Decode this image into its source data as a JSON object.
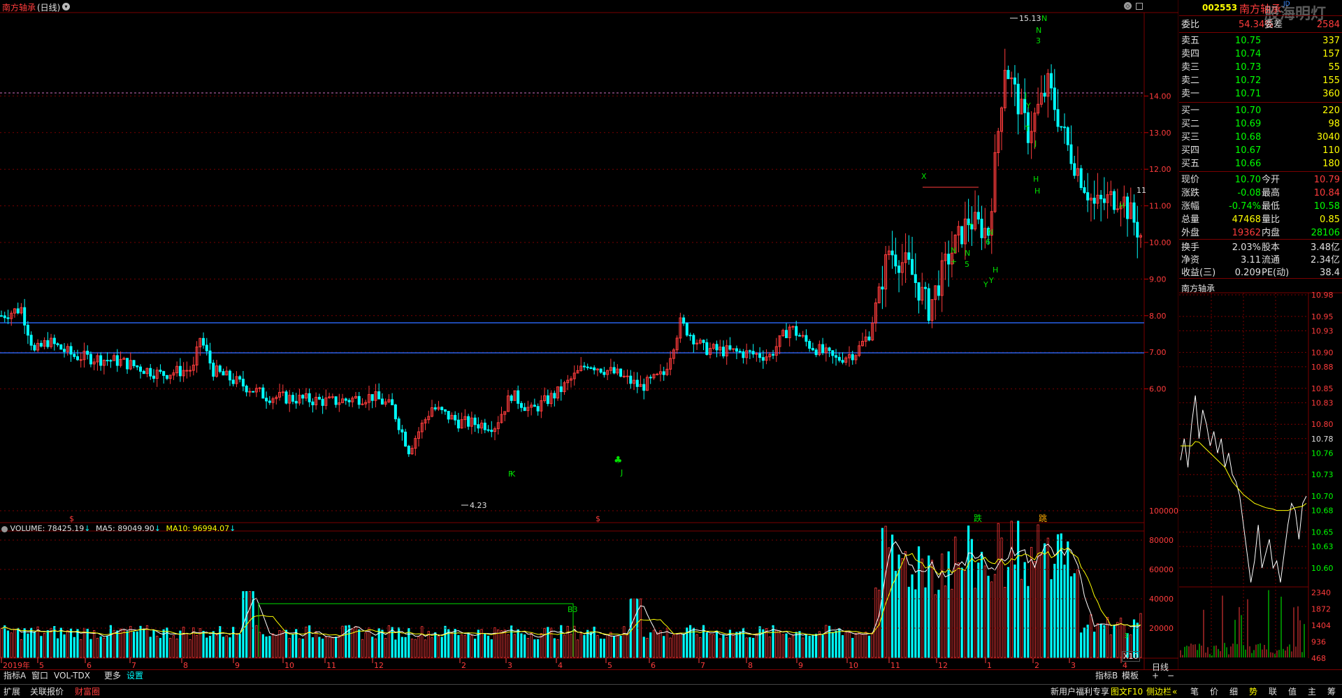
{
  "header": {
    "stock_name": "南方轴承",
    "period_tag": "(日线)",
    "chevron": "chevron-down-icon"
  },
  "price_axis": {
    "labels": [
      "14.00",
      "13.00",
      "12.00",
      "11.00",
      "10.00",
      "9.00",
      "8.00",
      "7.00",
      "6.00"
    ]
  },
  "annotations": {
    "high": "15.13",
    "low": "4.23",
    "last_label": "11"
  },
  "chart_letters": [
    "X",
    "N",
    "+",
    "N",
    "5",
    "T",
    "N",
    "6",
    "H",
    "Y",
    "N",
    "3",
    "J",
    "Y",
    "T",
    "J",
    "H",
    "H",
    "H",
    "Y",
    "F",
    "K",
    "J",
    "N"
  ],
  "event_labels": [
    "跌",
    "跳"
  ],
  "volume": {
    "name": "VOLUME:",
    "value": "78425.19",
    "ma5_label": "MA5:",
    "ma5": "89049.90",
    "ma10_label": "MA10:",
    "ma10": "96994.07",
    "axis": [
      "100000",
      "80000",
      "60000",
      "40000",
      "20000"
    ],
    "x10": "X10",
    "box_label": "B3",
    "tiny_label": "3"
  },
  "date_axis": [
    "2019年",
    "5",
    "6",
    "7",
    "8",
    "9",
    "10",
    "11",
    "12",
    "2",
    "3",
    "4",
    "5",
    "6",
    "7",
    "8",
    "9",
    "10",
    "11",
    "12",
    "1",
    "2",
    "3",
    "4"
  ],
  "bottom_tabs": [
    "指标A",
    "窗口",
    "VOL-TDX",
    "更多",
    "设置"
  ],
  "bottom_tabs2": [
    "扩展",
    "关联报价",
    "财富圈"
  ],
  "right_bottom": [
    "指标B",
    "模板"
  ],
  "status_right": [
    "新用户福利专享",
    "图文F10",
    "侧边栏"
  ],
  "small_buttons": [
    "+",
    "−"
  ],
  "period_label": "日线",
  "quote": {
    "code": "002553",
    "name": "南方轴承",
    "watermark": "股海明灯",
    "weibi_label": "委比",
    "weibi_pct": "54.34%",
    "weibi_diff_label": "委差",
    "weibi_diff": "2584",
    "asks": [
      {
        "label": "卖五",
        "price": "10.75",
        "vol": "337"
      },
      {
        "label": "卖四",
        "price": "10.74",
        "vol": "157"
      },
      {
        "label": "卖三",
        "price": "10.73",
        "vol": "55"
      },
      {
        "label": "卖二",
        "price": "10.72",
        "vol": "155"
      },
      {
        "label": "卖一",
        "price": "10.71",
        "vol": "360"
      }
    ],
    "bids": [
      {
        "label": "买一",
        "price": "10.70",
        "vol": "220"
      },
      {
        "label": "买二",
        "price": "10.69",
        "vol": "98"
      },
      {
        "label": "买三",
        "price": "10.68",
        "vol": "3040"
      },
      {
        "label": "买四",
        "price": "10.67",
        "vol": "110"
      },
      {
        "label": "买五",
        "price": "10.66",
        "vol": "180"
      }
    ],
    "stats": [
      {
        "l1": "现价",
        "v1": "10.70",
        "l2": "今开",
        "v2": "10.79",
        "c1": "#00ff00",
        "c2": "#ff3c3c"
      },
      {
        "l1": "涨跌",
        "v1": "-0.08",
        "l2": "最高",
        "v2": "10.84",
        "c1": "#00ff00",
        "c2": "#ff3c3c"
      },
      {
        "l1": "涨幅",
        "v1": "-0.74%",
        "l2": "最低",
        "v2": "10.58",
        "c1": "#00ff00",
        "c2": "#00ff00"
      },
      {
        "l1": "总量",
        "v1": "47468",
        "l2": "量比",
        "v2": "0.85",
        "c1": "#ffff00",
        "c2": "#ffff00"
      },
      {
        "l1": "外盘",
        "v1": "19362",
        "l2": "内盘",
        "v2": "28106",
        "c1": "#ff3c3c",
        "c2": "#00ff00"
      }
    ],
    "stats2": [
      {
        "l1": "换手",
        "v1": "2.03%",
        "l2": "股本",
        "v2": "3.48亿"
      },
      {
        "l1": "净资",
        "v1": "3.11",
        "l2": "流通",
        "v2": "2.34亿"
      },
      {
        "l1": "收益(三)",
        "v1": "0.209",
        "l2": "PE(动)",
        "v2": "38.4"
      }
    ]
  },
  "intraday": {
    "title": "南方轴承",
    "price_axis": [
      "10.98",
      "10.95",
      "10.93",
      "10.90",
      "10.88",
      "10.85",
      "10.83",
      "10.80",
      "10.78",
      "10.76",
      "10.73",
      "10.70",
      "10.68",
      "10.65",
      "10.63",
      "10.60"
    ],
    "vol_axis": [
      "2340",
      "1872",
      "1404",
      "936",
      "468"
    ]
  },
  "side_tabs": [
    "笔",
    "价",
    "细",
    "势",
    "联",
    "值",
    "主",
    "筹"
  ],
  "colors": {
    "up": "#ff3c3c",
    "down": "#00ffff",
    "bg": "#000000",
    "grid": "#7a0000",
    "ma5": "#ffffff",
    "ma10": "#ffff00",
    "hline": "#2860e8",
    "quote_name": "#ff3c3c"
  }
}
